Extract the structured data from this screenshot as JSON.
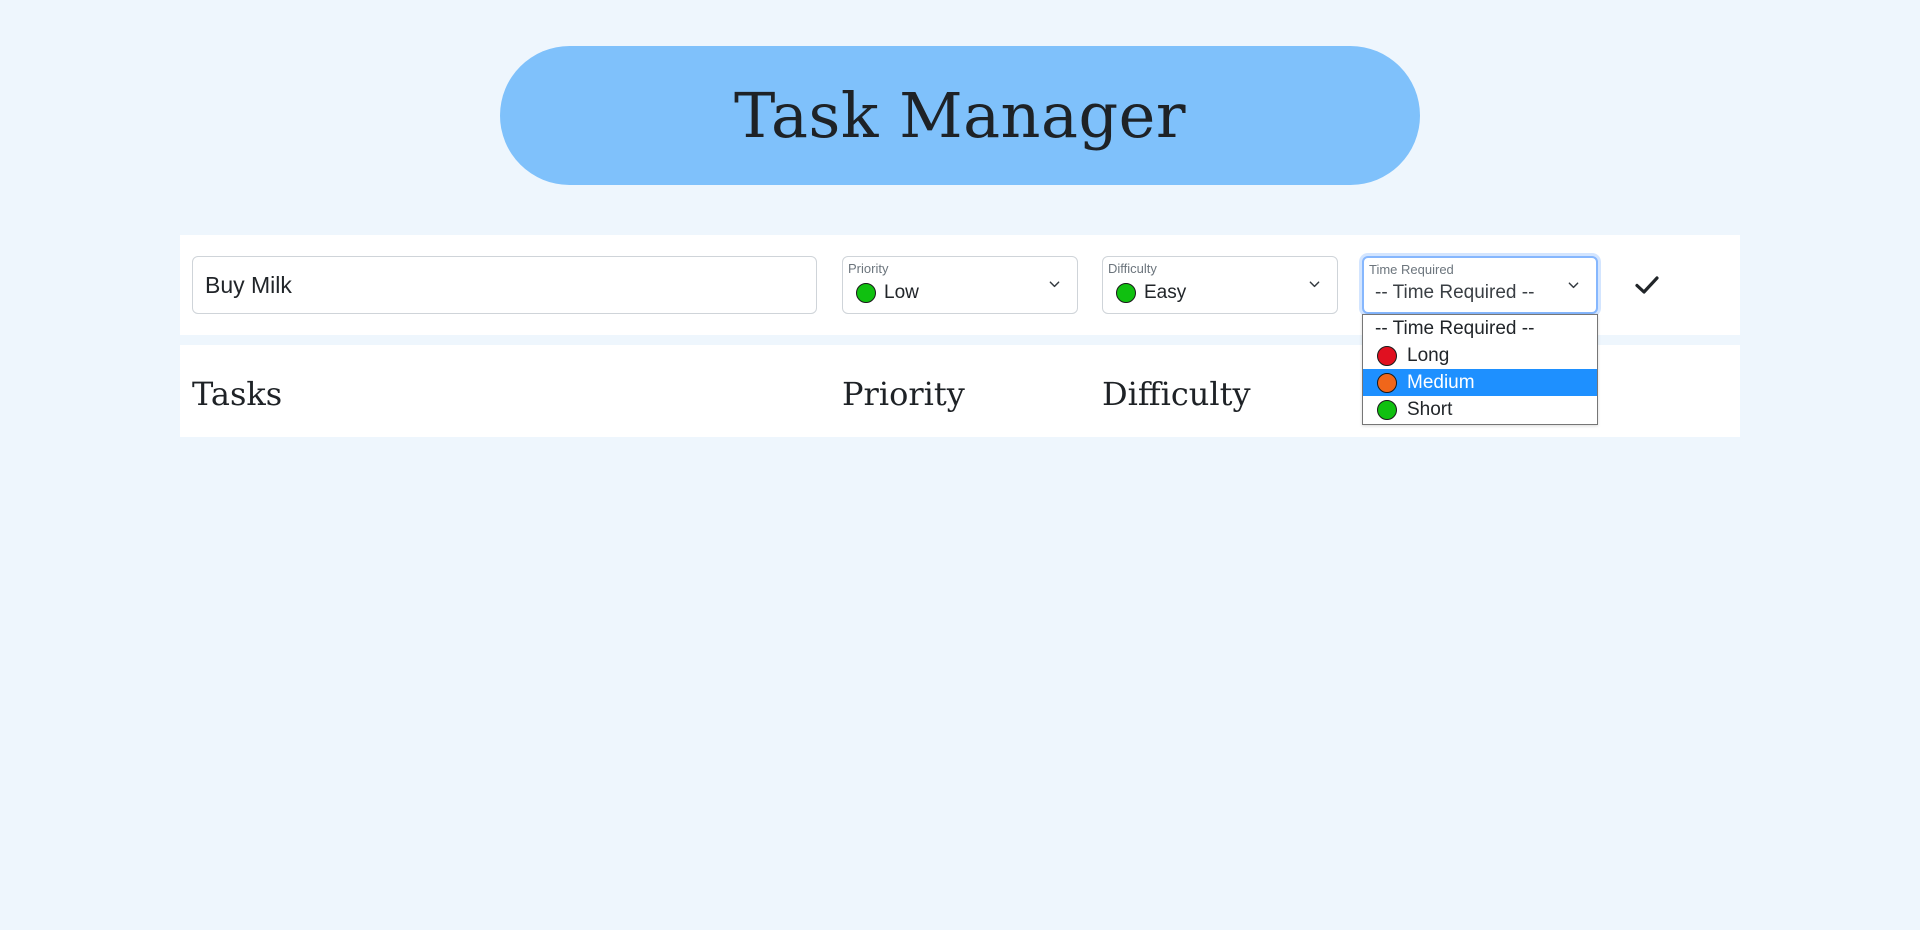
{
  "header": {
    "title": "Task Manager"
  },
  "form": {
    "task_input_value": "Buy Milk",
    "priority": {
      "label": "Priority",
      "selected": "Low",
      "dot_color": "#10c010"
    },
    "difficulty": {
      "label": "Difficulty",
      "selected": "Easy",
      "dot_color": "#10c010"
    },
    "time_required": {
      "label": "Time Required",
      "selected": "-- Time Required --"
    },
    "submit_icon": "check-icon"
  },
  "dropdown": {
    "options": [
      {
        "label": "-- Time Required --"
      },
      {
        "label": "Long",
        "dot_color": "#e01020"
      },
      {
        "label": "Medium",
        "dot_color": "#f0661a",
        "highlighted": true
      },
      {
        "label": "Short",
        "dot_color": "#10c010"
      }
    ]
  },
  "table": {
    "headers": [
      "Tasks",
      "Priority",
      "Difficulty"
    ]
  },
  "colors": {
    "page_background": "#eef6fd",
    "header_pill": "#7fc1fb",
    "highlight": "#1e90ff"
  }
}
